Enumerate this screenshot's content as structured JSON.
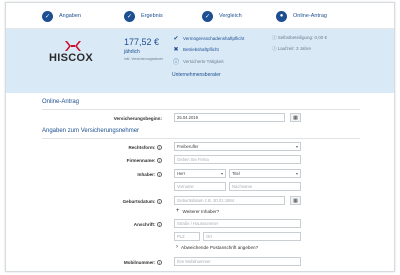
{
  "steps": [
    {
      "label": "Angaben"
    },
    {
      "label": "Ergebnis"
    },
    {
      "label": "Vergleich"
    },
    {
      "label": "Online-Antrag"
    }
  ],
  "summary": {
    "logo_text": "HISCOX",
    "price": "177,52 €",
    "period": "jährlich",
    "price_note": "inkl. Versicherungssteuer",
    "features": [
      {
        "text": "Vermögensschadenshaftpflicht",
        "icon": "check-icon"
      },
      {
        "text": "Betriebshaftpflicht",
        "icon": "cross-icon"
      },
      {
        "text": "Versicherte Tätigkeit",
        "icon": "info-icon"
      }
    ],
    "extra": "Unternehmensberater",
    "deductible": "Selbstbeteiligung: 0,00 €",
    "term": "Laufzeit: 3 Jahre",
    "brand_color": "#1d4f91",
    "panel_color": "#d9e9f6"
  },
  "online_antrag": {
    "title": "Online-Antrag",
    "start_label": "Versicherungsbeginn:",
    "start_value": "25.04.2019"
  },
  "policyholder": {
    "title": "Angaben zum Versicherungsnehmer",
    "legal_form_label": "Rechtsform:",
    "legal_form_value": "Freiberufler",
    "company_label": "Firmenname:",
    "company_placeholder": "Geben Sie Firma",
    "owner_label": "Inhaber:",
    "salutation_value": "Herr",
    "title_value": "Titel",
    "firstname_placeholder": "Vorname",
    "lastname_placeholder": "Nachname",
    "birthdate_label": "Geburtsdatum:",
    "birthdate_placeholder": "Geburtsdatum z.B. 30.01.1984",
    "add_owner_link": "Weiterer Inhaber?",
    "address_label": "Anschrift:",
    "street_placeholder": "Straße / Hausnummer",
    "zip_placeholder": "PLZ",
    "city_placeholder": "Ort",
    "alt_address_link": "Abweichende Postanschrift angeben?",
    "mobile_label": "Mobilnummer:",
    "mobile_placeholder": "Ihre Mobilnummer"
  }
}
